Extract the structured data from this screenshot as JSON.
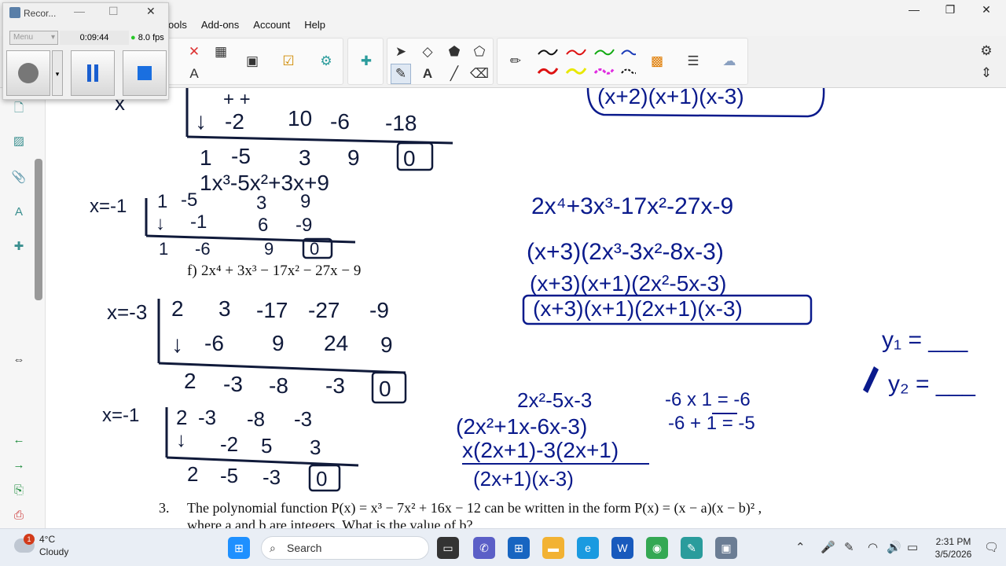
{
  "menu": [
    "ools",
    "Add-ons",
    "Account",
    "Help"
  ],
  "recorder": {
    "title": "Recor...",
    "menu_label": "Menu",
    "time": "0:09:44",
    "fps": "8.0 fps"
  },
  "math": {
    "top_right_factor": "(x+2)(x+1)(x-3)",
    "synth1_row_signs": "+          +",
    "synth1_row2": [
      "-2",
      "10",
      "-6",
      "-18"
    ],
    "synth1_row3": [
      "1",
      "-5",
      "3",
      "9",
      "0"
    ],
    "poly1": "1x³-5x²+3x+9",
    "synth2_label": "x=-1",
    "synth2_row1": [
      "1",
      "-5",
      "3",
      "9"
    ],
    "synth2_row2": [
      "-1",
      "6",
      "-9"
    ],
    "synth2_row3": [
      "1",
      "-6",
      "9",
      "0"
    ],
    "problem_f_label": "f)",
    "problem_f": "2x⁴ + 3x³ − 17x² − 27x − 9",
    "synth3_label": "x=-3",
    "synth3_row1": [
      "2",
      "3",
      "-17",
      "-27",
      "-9"
    ],
    "synth3_row2": [
      "-6",
      "9",
      "24",
      "9"
    ],
    "synth3_row3": [
      "2",
      "-3",
      "-8",
      "-3",
      "0"
    ],
    "synth4_label": "x=-1",
    "synth4_row1": [
      "2",
      "-3",
      "-8",
      "-3"
    ],
    "synth4_row2": [
      "-2",
      "5",
      "3"
    ],
    "synth4_row3": [
      "2",
      "-5",
      "-3",
      "0"
    ],
    "r_line1": "2x⁴+3x³-17x²-27x-9",
    "r_line2": "(x+3)(2x³-3x²-8x-3)",
    "r_line3": "(x+3)(x+1)(2x²-5x-3)",
    "r_line4": "(x+3)(x+1)(2x+1)(x-3)",
    "quad": "2x²-5x-3",
    "prod1": "-6 x 1 = -6",
    "sum1": "-6 + 1 = -5",
    "split": "(2x²+1x-6x-3)",
    "group": "x(2x+1)-3(2x+1)",
    "final": "(2x+1)(x-3)",
    "y1": "y₁ = ___",
    "y2": "y₂ = ___",
    "q3_num": "3.",
    "q3_text": "The polynomial function P(x) = x³ − 7x² + 16x − 12 can be written in the form P(x) = (x − a)(x − b)² ,",
    "q3_text2": "where a and b are integers. What is the value of b?"
  },
  "taskbar": {
    "temp": "4°C",
    "weather": "Cloudy",
    "badge": "1",
    "search_label": "Search",
    "time": "2:31 PM",
    "date": "3/5/2026"
  },
  "colors": {
    "ink": "#101a3a",
    "marker_blue": "#0a1a8c",
    "rec_green": "#28c828"
  }
}
